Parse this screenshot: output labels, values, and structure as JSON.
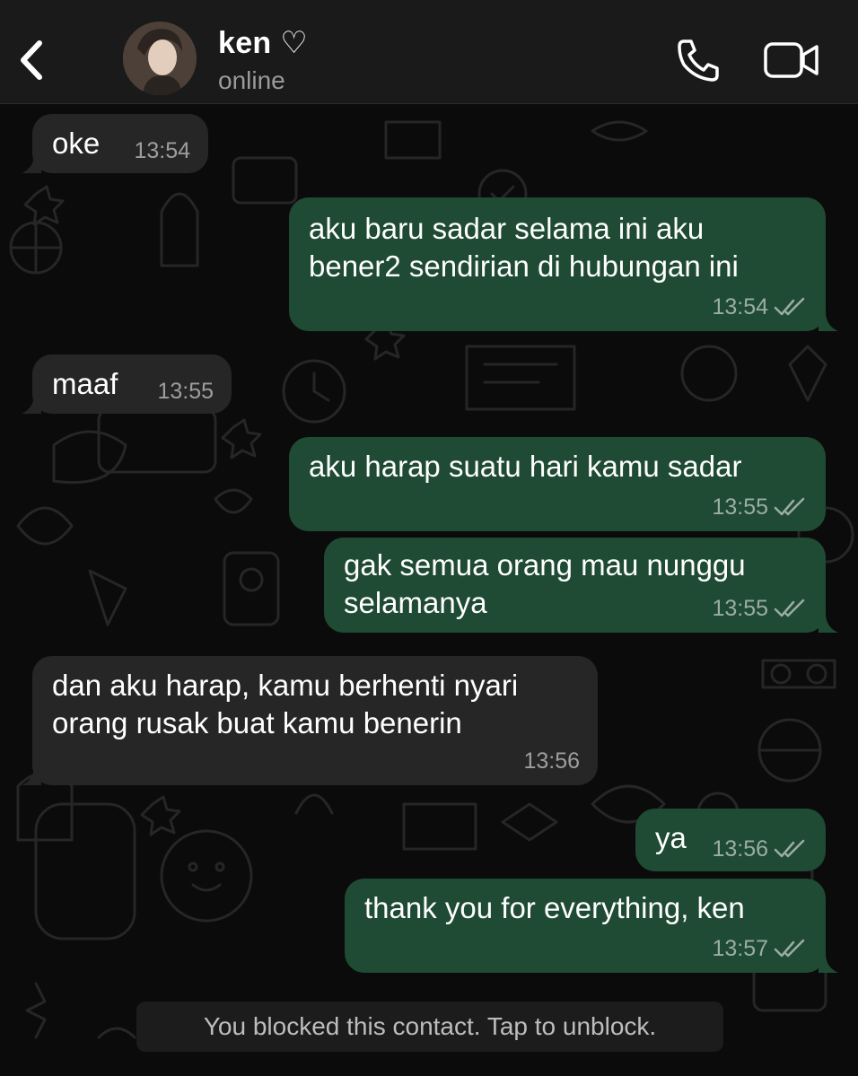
{
  "header": {
    "contact_name": "ken ♡",
    "status": "online",
    "icons": {
      "back": "chevron-left-icon",
      "call": "phone-icon",
      "video": "video-camera-icon"
    }
  },
  "colors": {
    "background": "#0b0b0b",
    "header": "#1a1a1a",
    "incoming_bubble": "#262626",
    "outgoing_bubble": "#1f4a33",
    "timestamp": "#8f9a93"
  },
  "messages": [
    {
      "direction": "incoming",
      "text": "oke",
      "time": "13:54"
    },
    {
      "direction": "outgoing",
      "text": "aku baru sadar selama ini aku\nbener2 sendirian di hubungan ini",
      "time": "13:54",
      "ticks": "double-check-icon"
    },
    {
      "direction": "incoming",
      "text": "maaf",
      "time": "13:55"
    },
    {
      "direction": "outgoing",
      "text": "aku harap suatu hari kamu sadar",
      "time": "13:55",
      "ticks": "double-check-icon"
    },
    {
      "direction": "outgoing",
      "text": "gak semua orang mau nunggu\nselamanya",
      "time": "13:55",
      "ticks": "double-check-icon"
    },
    {
      "direction": "incoming",
      "text": "dan aku harap, kamu berhenti nyari\norang rusak buat kamu benerin",
      "time": "13:56"
    },
    {
      "direction": "outgoing",
      "text": "ya",
      "time": "13:56",
      "ticks": "double-check-icon"
    },
    {
      "direction": "outgoing",
      "text": "thank you for everything, ken",
      "time": "13:57",
      "ticks": "double-check-icon"
    }
  ],
  "blocked_notice": "You blocked this contact. Tap to unblock."
}
